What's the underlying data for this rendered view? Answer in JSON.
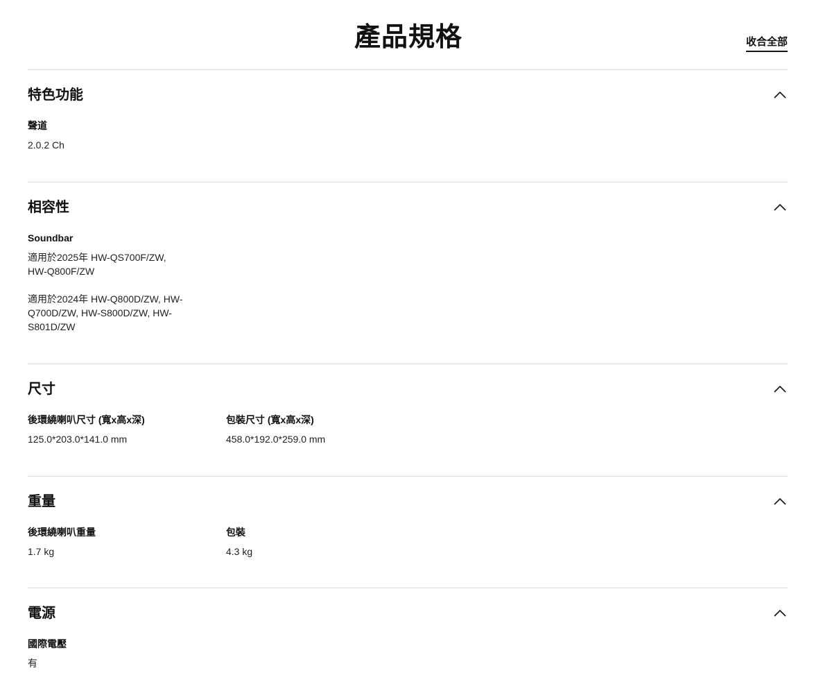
{
  "header": {
    "title": "產品規格",
    "collapse_all_label": "收合全部"
  },
  "sections": [
    {
      "title": "特色功能",
      "specs": [
        {
          "label": "聲道",
          "value": "2.0.2 Ch"
        }
      ]
    },
    {
      "title": "相容性",
      "specs": [
        {
          "label": "Soundbar",
          "value": "適用於2025年 HW-QS700F/ZW,\nHW-Q800F/ZW\n\n適用於2024年 HW-Q800D/ZW, HW-\nQ700D/ZW, HW-S800D/ZW, HW-\nS801D/ZW"
        }
      ]
    },
    {
      "title": "尺寸",
      "specs": [
        {
          "label": "後環繞喇叭尺寸 (寬x高x深)",
          "value": "125.0*203.0*141.0 mm"
        },
        {
          "label": "包裝尺寸 (寬x高x深)",
          "value": "458.0*192.0*259.0 mm"
        }
      ]
    },
    {
      "title": "重量",
      "specs": [
        {
          "label": "後環繞喇叭重量",
          "value": "1.7 kg"
        },
        {
          "label": "包裝",
          "value": "4.3 kg"
        }
      ]
    },
    {
      "title": "電源",
      "specs": [
        {
          "label": "國際電壓",
          "value": "有"
        }
      ]
    }
  ],
  "icons": {
    "section_toggle": "chevron-up-icon"
  },
  "colors": {
    "text": "#111111",
    "divider": "#dcdcdc",
    "background": "#ffffff"
  }
}
